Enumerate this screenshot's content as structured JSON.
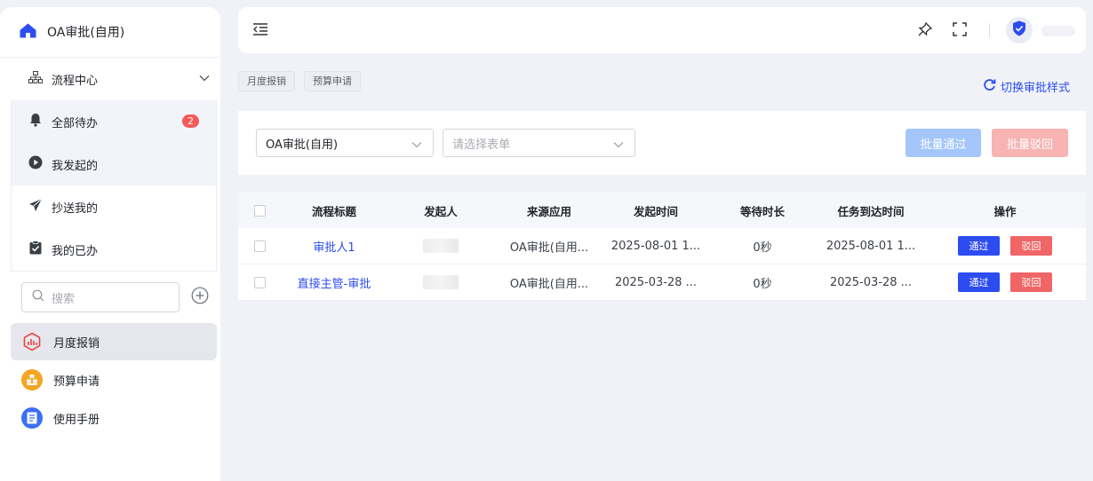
{
  "sidebar": {
    "brand_title": "OA审批(自用)",
    "group_label": "流程中心",
    "nav_items": [
      {
        "label": "全部待办",
        "badge": "2"
      },
      {
        "label": "我发起的"
      },
      {
        "label": "抄送我的"
      },
      {
        "label": "我的已办"
      }
    ],
    "search_placeholder": "搜索",
    "apps": [
      {
        "label": "月度报销",
        "icon": "report-icon",
        "color": "#e8453c"
      },
      {
        "label": "预算申请",
        "icon": "budget-icon",
        "color": "#f5a524"
      },
      {
        "label": "使用手册",
        "icon": "manual-icon",
        "color": "#3b6ff5"
      }
    ]
  },
  "tabs": [
    "月度报销",
    "预算申请"
  ],
  "switch_style_label": "切换审批样式",
  "filters": {
    "form_select_value": "OA审批(自用)",
    "form_select_placeholder": "请选择表单",
    "batch_pass_label": "批量通过",
    "batch_reject_label": "批量驳回"
  },
  "table": {
    "headers": [
      "流程标题",
      "发起人",
      "来源应用",
      "发起时间",
      "等待时长",
      "任务到达时间",
      "操作"
    ],
    "rows": [
      {
        "title": "审批人1",
        "app": "OA审批(自用...",
        "start": "2025-08-01 1...",
        "wait": "0秒",
        "arrive": "2025-08-01 1..."
      },
      {
        "title": "直接主管-审批",
        "app": "OA审批(自用...",
        "start": "2025-03-28 ...",
        "wait": "0秒",
        "arrive": "2025-03-28 ..."
      }
    ],
    "pass_label": "通过",
    "reject_label": "驳回"
  },
  "colors": {
    "accent": "#2d4cf0",
    "danger": "#f06565",
    "badge": "#f5595a"
  }
}
